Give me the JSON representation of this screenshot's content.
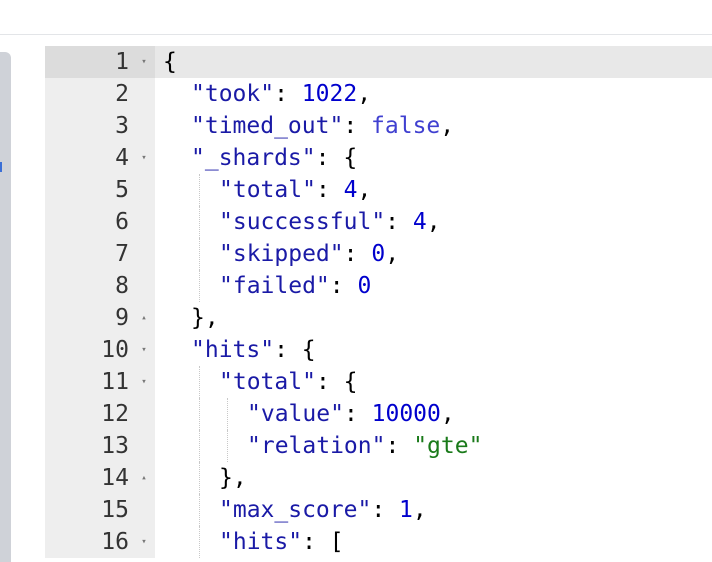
{
  "editor": {
    "lines": [
      {
        "n": "1",
        "fold": "▾",
        "indent": 0,
        "active": true,
        "tokens": [
          {
            "t": "p",
            "v": "{"
          }
        ]
      },
      {
        "n": "2",
        "fold": "",
        "indent": 1,
        "tokens": [
          {
            "t": "k",
            "v": "\"took\""
          },
          {
            "t": "p",
            "v": ": "
          },
          {
            "t": "n",
            "v": "1022"
          },
          {
            "t": "p",
            "v": ","
          }
        ]
      },
      {
        "n": "3",
        "fold": "",
        "indent": 1,
        "tokens": [
          {
            "t": "k",
            "v": "\"timed_out\""
          },
          {
            "t": "p",
            "v": ": "
          },
          {
            "t": "b",
            "v": "false"
          },
          {
            "t": "p",
            "v": ","
          }
        ]
      },
      {
        "n": "4",
        "fold": "▾",
        "indent": 1,
        "tokens": [
          {
            "t": "k",
            "v": "\"_shards\""
          },
          {
            "t": "p",
            "v": ": {"
          }
        ]
      },
      {
        "n": "5",
        "fold": "",
        "indent": 2,
        "tokens": [
          {
            "t": "k",
            "v": "\"total\""
          },
          {
            "t": "p",
            "v": ": "
          },
          {
            "t": "n",
            "v": "4"
          },
          {
            "t": "p",
            "v": ","
          }
        ]
      },
      {
        "n": "6",
        "fold": "",
        "indent": 2,
        "tokens": [
          {
            "t": "k",
            "v": "\"successful\""
          },
          {
            "t": "p",
            "v": ": "
          },
          {
            "t": "n",
            "v": "4"
          },
          {
            "t": "p",
            "v": ","
          }
        ]
      },
      {
        "n": "7",
        "fold": "",
        "indent": 2,
        "tokens": [
          {
            "t": "k",
            "v": "\"skipped\""
          },
          {
            "t": "p",
            "v": ": "
          },
          {
            "t": "n",
            "v": "0"
          },
          {
            "t": "p",
            "v": ","
          }
        ]
      },
      {
        "n": "8",
        "fold": "",
        "indent": 2,
        "tokens": [
          {
            "t": "k",
            "v": "\"failed\""
          },
          {
            "t": "p",
            "v": ": "
          },
          {
            "t": "n",
            "v": "0"
          }
        ]
      },
      {
        "n": "9",
        "fold": "▴",
        "indent": 1,
        "tokens": [
          {
            "t": "p",
            "v": "},"
          }
        ]
      },
      {
        "n": "10",
        "fold": "▾",
        "indent": 1,
        "tokens": [
          {
            "t": "k",
            "v": "\"hits\""
          },
          {
            "t": "p",
            "v": ": {"
          }
        ]
      },
      {
        "n": "11",
        "fold": "▾",
        "indent": 2,
        "tokens": [
          {
            "t": "k",
            "v": "\"total\""
          },
          {
            "t": "p",
            "v": ": {"
          }
        ]
      },
      {
        "n": "12",
        "fold": "",
        "indent": 3,
        "tokens": [
          {
            "t": "k",
            "v": "\"value\""
          },
          {
            "t": "p",
            "v": ": "
          },
          {
            "t": "n",
            "v": "10000"
          },
          {
            "t": "p",
            "v": ","
          }
        ]
      },
      {
        "n": "13",
        "fold": "",
        "indent": 3,
        "tokens": [
          {
            "t": "k",
            "v": "\"relation\""
          },
          {
            "t": "p",
            "v": ": "
          },
          {
            "t": "s",
            "v": "\"gte\""
          }
        ]
      },
      {
        "n": "14",
        "fold": "▴",
        "indent": 2,
        "tokens": [
          {
            "t": "p",
            "v": "},"
          }
        ]
      },
      {
        "n": "15",
        "fold": "",
        "indent": 2,
        "tokens": [
          {
            "t": "k",
            "v": "\"max_score\""
          },
          {
            "t": "p",
            "v": ": "
          },
          {
            "t": "n",
            "v": "1"
          },
          {
            "t": "p",
            "v": ","
          }
        ]
      },
      {
        "n": "16",
        "fold": "▾",
        "indent": 2,
        "tokens": [
          {
            "t": "k",
            "v": "\"hits\""
          },
          {
            "t": "p",
            "v": ": ["
          }
        ]
      }
    ]
  },
  "colors": {
    "key": "#1a1aa6",
    "string": "#1a7a1a",
    "number": "#0000cd",
    "boolean": "#4040d0",
    "gutter": "#eeeeee"
  }
}
